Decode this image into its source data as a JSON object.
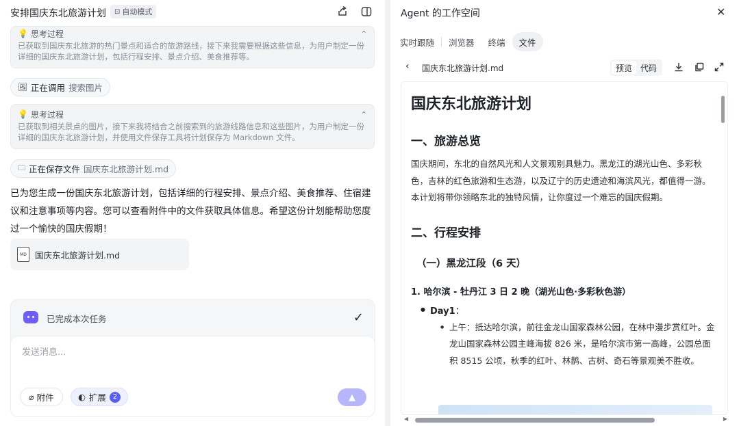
{
  "left": {
    "title": "安排国庆东北旅游计划",
    "mode_badge": "自动模式",
    "think1": {
      "label": "思考过程",
      "text": "已获取到国庆东北旅游的热门景点和适合的旅游路线，接下来我需要根据这些信息，为用户制定一份详细的国庆东北旅游计划，包括行程安排、景点介绍、美食推荐等。"
    },
    "action1": {
      "label": "正在调用",
      "target": "搜索图片"
    },
    "think2": {
      "label": "思考过程",
      "text": "已获取到相关景点的图片，接下来我将结合之前搜索到的旅游线路信息和这些图片，为用户制定一份详细的国庆东北旅游计划，并使用文件保存工具将计划保存为 Markdown 文件。"
    },
    "action2": {
      "label": "正在保存文件",
      "target": "国庆东北旅游计划.md"
    },
    "answer": "已为您生成一份国庆东北旅游计划，包括详细的行程安排、景点介绍、美食推荐、住宿建议和注意事项等内容。您可以查看附件中的文件获取具体信息。希望这份计划能帮助您度过一个愉快的国庆假期！",
    "file_card": {
      "icon_text": "MD",
      "name": "国庆东北旅游计划.md"
    },
    "task_status": "已完成本次任务",
    "input_placeholder": "发送消息...",
    "attach_label": "附件",
    "extension_label": "扩展",
    "extension_count": "2"
  },
  "right": {
    "title": "Agent 的工作空间",
    "tabs": [
      "实时跟随",
      "浏览器",
      "终端",
      "文件"
    ],
    "active_tab": "文件",
    "file_name": "国庆东北旅游计划.md",
    "view_preview": "预览",
    "view_code": "代码",
    "doc": {
      "h1": "国庆东北旅游计划",
      "s1_title": "一、旅游总览",
      "s1_text": "国庆期间，东北的自然风光和人文景观别具魅力。黑龙江的湖光山色、多彩秋色，吉林的红色旅游和生态游，以及辽宁的历史遗迹和海滨风光，都值得一游。本计划将带你领略东北的独特风情，让你度过一个难忘的国庆假期。",
      "s2_title": "二、行程安排",
      "s2_sub": "（一）黑龙江段（6 天）",
      "route_title": "1. 哈尔滨 - 牡丹江 3 日 2 晚（湖光山色·多彩秋色游）",
      "day1_label": "Day1",
      "day1_colon": "：",
      "day1_item": "上午：抵达哈尔滨，前往金龙山国家森林公园，在林中漫步赏红叶。金龙山国家森林公园主峰海拔 826 米，是哈尔滨市第一高峰，公园总面积 8515 公顷，秋季的红叶、林鹊、古树、奇石等景观美不胜收。"
    }
  }
}
